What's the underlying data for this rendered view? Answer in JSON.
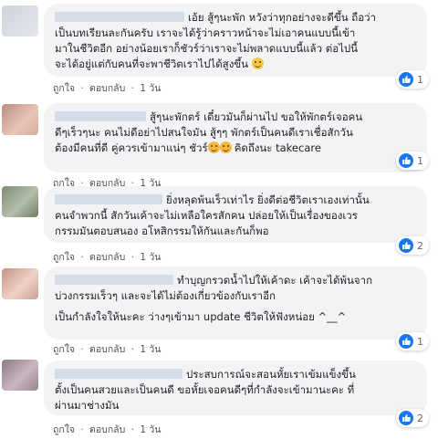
{
  "common": {
    "like_label": "ถูกใจ",
    "dot": "·",
    "reply_label": "ตอบกลับ",
    "time_label": "1 วัน"
  },
  "colors": {
    "like_blue": "#1877f2",
    "bubble_bg": "#f2f3f5"
  },
  "comments": [
    {
      "lines": [
        "เอ้ย สู้ๆนะพัก หวังว่าทุกอย่างจะดีขึ้น ถือว่า",
        "เป็นบทเรียนละกันครับ เราจะได้รู้ว่าคราวหน้าจะไม่เอาคนแบบนี้เข้า",
        "มาในชีวิตอีก อย่างน้อยเราก็ชัวร์ว่าเราจะไม่พลาดแบบนี้แล้ว ต่อไปนี้",
        "จะได้อยู่แต่กับคนที่จะพาชีวิตเราไปได้สูงขึ้น"
      ],
      "like_count": "1"
    },
    {
      "lines": [
        "สู้ๆนะพักตร์ เดี๋ยวมันก็ผ่านไป ขอให้พักตร์เจอคน",
        "ดีๆเร็วๆนะ คนไม่ดีอย่าไปสนใจมัน สู้ๆๆ พักตร์เป็นคนดีเราเชื่อสักวัน",
        "ต้องมีคนที่ดี คู่ควรเข้ามาแน่ๆ ชัวร์",
        "คิดถึงนะ takecare"
      ],
      "like_count": "1"
    },
    {
      "lines": [
        "ยิ่งหลุดพ้นเร็วเท่าไร ยิ่งดีต่อชีวิตเราเองเท่านั้น",
        "คนจำพวกนี้ สักวันเค้าจะไม่เหลือใครสักคน ปล่อยให้เป็นเรื่องของเวร",
        "กรรมมันตอบสนอง อโหสิกรรมให้กันและกันก็พอ"
      ],
      "like_count": "2"
    },
    {
      "lines": [
        "ทำบุญกรวดน้ำไปให้เค้าดะ เค้าจะได้พ้นจาก",
        "บ่วงกรรมเร็วๆ และจะได้ไม่ต้องเกี่ยวข้องกับเราอีก",
        "เป็นกำลังใจให้นะคะ ว่างๆเข้ามา update ชีวิตให้ฟังหน่อย ^__^"
      ],
      "like_count": "1"
    },
    {
      "lines": [
        "ประสบการณ์จะสอนหั้ยเราเข้มแข็งขึ้น",
        "ตั้งเป็นคนสวยและเป็นคนดี ขอหั้ยเจอคนดีๆที่กำลังจะเข้ามานะคะ ที่",
        "ผ่านมาช่างมัน"
      ],
      "like_count": "2"
    }
  ]
}
